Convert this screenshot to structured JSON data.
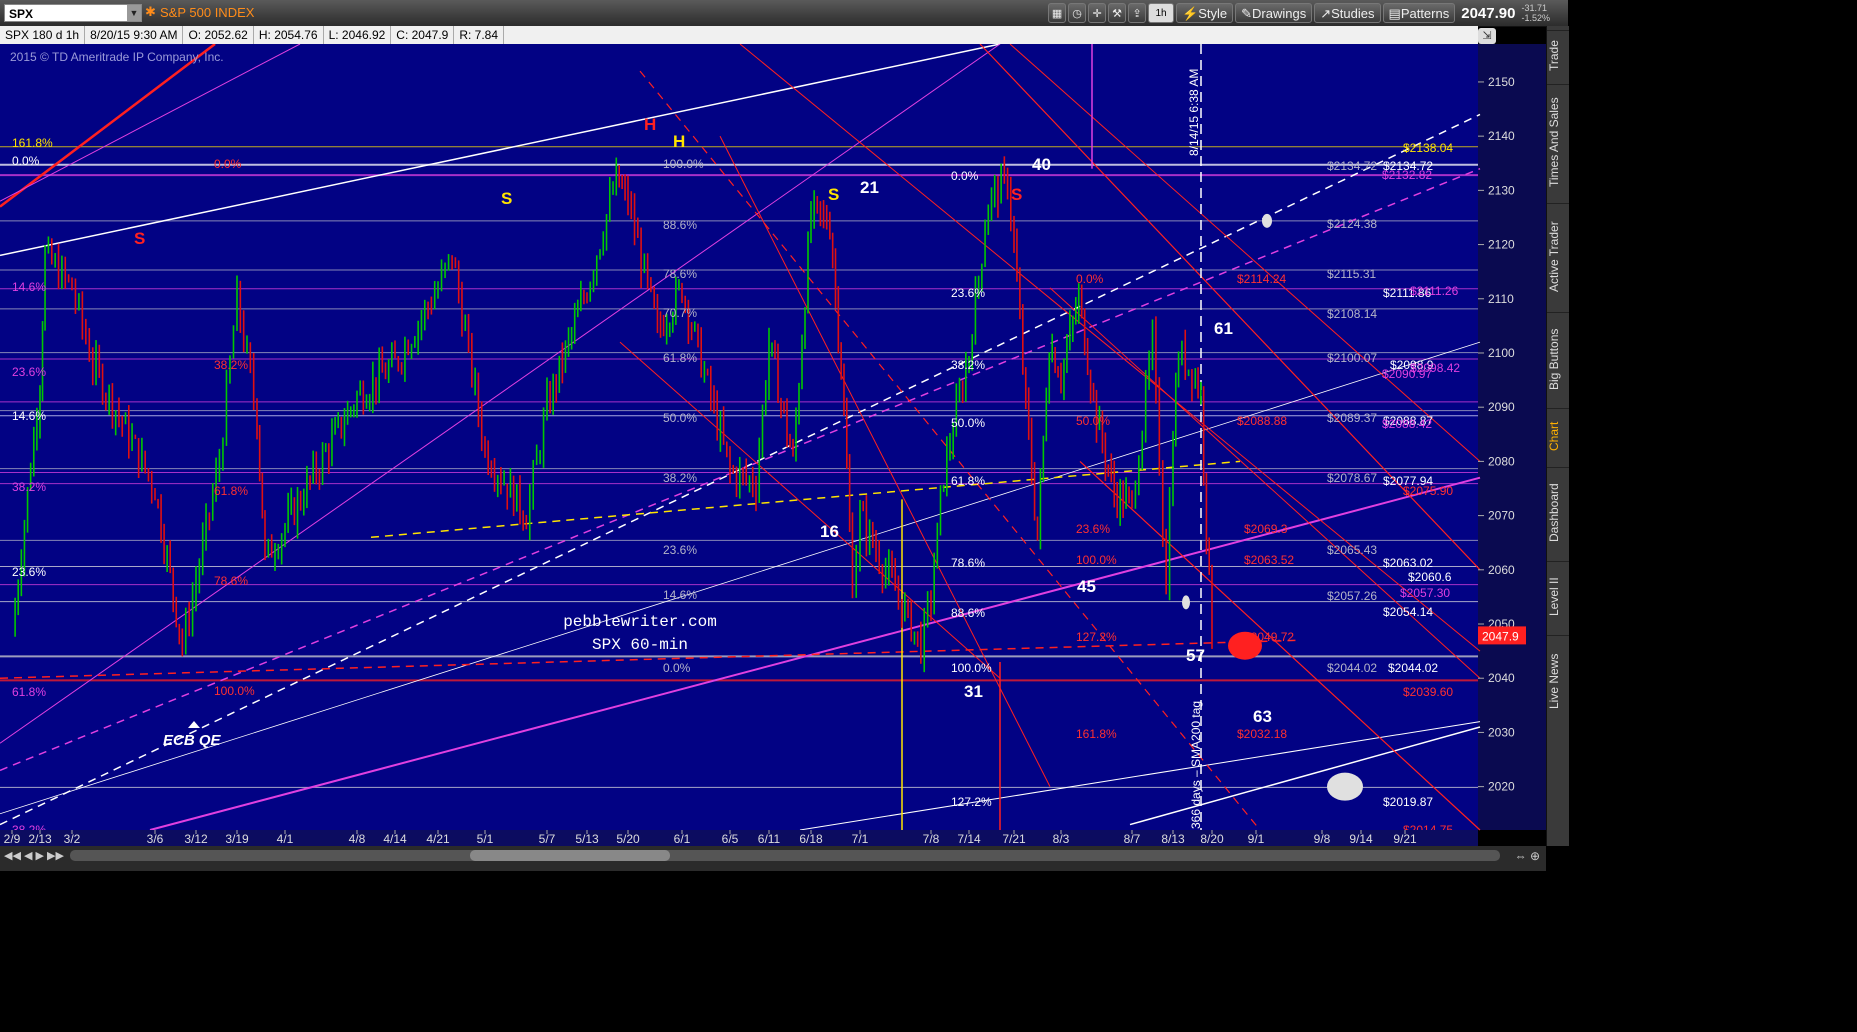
{
  "header": {
    "symbol": "SPX",
    "index_title": "S&P 500 INDEX",
    "buttons": {
      "interval": "1h",
      "style": "Style",
      "drawings": "Drawings",
      "studies": "Studies",
      "patterns": "Patterns"
    },
    "last_price": "2047.90",
    "change": "-31.71",
    "change_pct": "-1.52%"
  },
  "infobar": {
    "descriptor": "SPX 180 d 1h",
    "date": "8/20/15 9:30 AM",
    "open": "O: 2052.62",
    "high": "H: 2054.76",
    "low": "L: 2046.92",
    "close": "C: 2047.9",
    "range": "R: 7.84"
  },
  "copyright": "2015 © TD Ameritrade IP Company, Inc.",
  "sidebar": {
    "tabs": [
      "Trade",
      "Times And Sales",
      "Active Trader",
      "Big Buttons",
      "Chart",
      "Dashboard",
      "Level II",
      "Live News"
    ]
  },
  "chart_data": {
    "type": "candlestick",
    "title": "pebblewriter.com",
    "subtitle": "SPX 60-min",
    "symbol": "SPX",
    "interval": "1h",
    "ylim": [
      2012,
      2157
    ],
    "x_tick_labels": [
      "2/9",
      "2/13",
      "3/2",
      "3/6",
      "3/12",
      "3/19",
      "4/1",
      "4/8",
      "4/14",
      "4/21",
      "5/1",
      "5/7",
      "5/13",
      "5/20",
      "6/1",
      "6/5",
      "6/11",
      "6/18",
      "7/1",
      "7/8",
      "7/14",
      "7/21",
      "8/3",
      "8/7",
      "8/13",
      "8/20",
      "9/1",
      "9/8",
      "9/14",
      "9/21"
    ],
    "y_ticks": [
      2020,
      2030,
      2040,
      2050,
      2060,
      2070,
      2080,
      2090,
      2100,
      2110,
      2120,
      2130,
      2140,
      2150
    ],
    "last_price_label": "2047.9",
    "price_path": [
      [
        "2/9",
        2048
      ],
      [
        "2/13",
        2095
      ],
      [
        "2/16",
        2118
      ],
      [
        "3/2",
        2112
      ],
      [
        "3/3",
        2098
      ],
      [
        "3/6",
        2075
      ],
      [
        "3/10",
        2046
      ],
      [
        "3/12",
        2058
      ],
      [
        "3/16",
        2080
      ],
      [
        "3/19",
        2110
      ],
      [
        "3/24",
        2088
      ],
      [
        "3/26",
        2062
      ],
      [
        "4/1",
        2068
      ],
      [
        "4/8",
        2092
      ],
      [
        "4/14",
        2098
      ],
      [
        "4/21",
        2112
      ],
      [
        "4/24",
        2118
      ],
      [
        "5/1",
        2082
      ],
      [
        "5/5",
        2070
      ],
      [
        "5/7",
        2090
      ],
      [
        "5/13",
        2112
      ],
      [
        "5/18",
        2132
      ],
      [
        "5/20",
        2128
      ],
      [
        "5/26",
        2104
      ],
      [
        "6/1",
        2112
      ],
      [
        "6/5",
        2078
      ],
      [
        "6/9",
        2076
      ],
      [
        "6/11",
        2102
      ],
      [
        "6/15",
        2080
      ],
      [
        "6/18",
        2126
      ],
      [
        "6/23",
        2124
      ],
      [
        "6/26",
        2098
      ],
      [
        "6/29",
        2058
      ],
      [
        "7/1",
        2070
      ],
      [
        "7/7",
        2046
      ],
      [
        "7/8",
        2055
      ],
      [
        "7/10",
        2078
      ],
      [
        "7/14",
        2100
      ],
      [
        "7/17",
        2128
      ],
      [
        "7/20",
        2132
      ],
      [
        "7/21",
        2120
      ],
      [
        "7/24",
        2090
      ],
      [
        "7/27",
        2066
      ],
      [
        "7/30",
        2102
      ],
      [
        "8/3",
        2096
      ],
      [
        "8/4",
        2110
      ],
      [
        "8/5",
        2088
      ],
      [
        "8/6",
        2074
      ],
      [
        "8/7",
        2072
      ],
      [
        "8/10",
        2102
      ],
      [
        "8/12",
        2058
      ],
      [
        "8/13",
        2086
      ],
      [
        "8/14",
        2100
      ],
      [
        "8/17",
        2096
      ],
      [
        "8/18",
        2092
      ],
      [
        "8/19",
        2068
      ],
      [
        "8/20",
        2047.9
      ]
    ],
    "price_labels_white": [
      "$2134.72",
      "$2111.86",
      "$2098.9",
      "$2088.87",
      "$2077.94",
      "$2063.02",
      "$2060.6",
      "$2054.14",
      "$2044.02",
      "$2019.87"
    ],
    "price_labels_gray": [
      "$2134.72",
      "$2124.38",
      "$2115.31",
      "$2108.14",
      "$2100.07",
      "$2089.37",
      "$2078.67",
      "$2065.43",
      "$2057.26",
      "$2044.02"
    ],
    "price_labels_red": [
      "$2114.24",
      "$2088.88",
      "$2069.3",
      "$2063.52",
      "$2049.72",
      "$2032.18",
      "$2039.60",
      "$2014.75",
      "$2075.90"
    ],
    "price_labels_yellow": [
      "$2138.04"
    ],
    "price_labels_magenta": [
      "$2132.82",
      "$2111.26",
      "$2090.97",
      "$2098.42",
      "$2088.42",
      "$2057.30"
    ],
    "fib_labels_left": [
      "161.8%",
      "0.0%",
      "14.6%",
      "23.6%",
      "14.6%",
      "38.2%",
      "23.6%",
      "61.8%",
      "38.2%"
    ],
    "fib_labels_mid": [
      "0.0%",
      "38.2%",
      "61.8%",
      "78.6%",
      "100.0%"
    ],
    "fib_labels_gray": [
      "100.0%",
      "88.6%",
      "78.6%",
      "70.7%",
      "61.8%",
      "50.0%",
      "38.2%",
      "23.6%",
      "14.6%",
      "0.0%"
    ],
    "fib_labels_right": [
      "0.0%",
      "23.6%",
      "38.2%",
      "50.0%",
      "61.8%",
      "78.6%",
      "88.6%",
      "100.0%",
      "127.2%"
    ],
    "fib_labels_red": [
      "0.0%",
      "50.0%",
      "23.6%",
      "100.0%",
      "127.2%",
      "161.8%"
    ],
    "pattern_labels": [
      "S",
      "H",
      "H",
      "S",
      "S",
      "S",
      "21",
      "40",
      "16",
      "45",
      "61",
      "57",
      "31",
      "63"
    ],
    "annotations": [
      "ECB QE",
      "8/14/15 6:38 AM",
      "366 days – SMA200 tag"
    ]
  },
  "colors": {
    "background": "#020284",
    "up_candle": "#00c800",
    "down_candle": "#e01010",
    "fib_gray": "#b4b4c8",
    "magenta": "#e040e0",
    "yellow": "#ffe400",
    "red": "#ff2020",
    "white": "#ffffff",
    "price_box": "#ff2020"
  }
}
